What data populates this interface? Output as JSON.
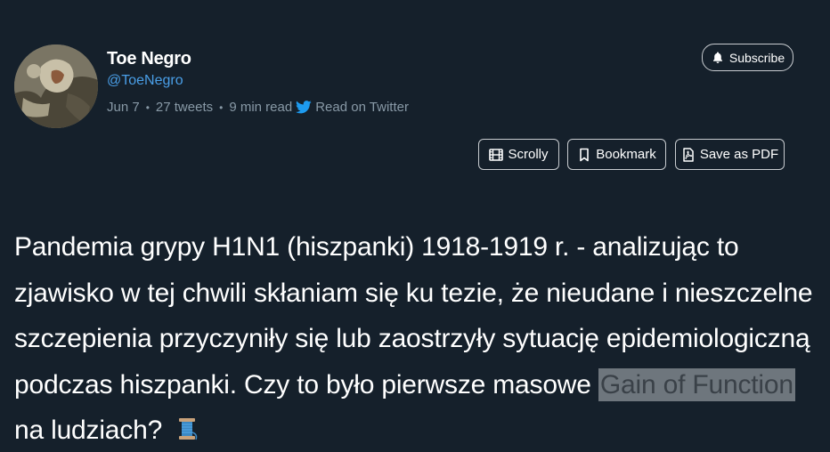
{
  "author": {
    "name": "Toe Negro",
    "handle": "@ToeNegro",
    "avatar": "avatar-image"
  },
  "meta": {
    "date": "Jun 7",
    "separator": "•",
    "tweets": "27 tweets",
    "read_time": "9 min read",
    "twitter_icon": "twitter-bird-icon",
    "read_on_twitter": "Read on Twitter"
  },
  "actions": {
    "subscribe": {
      "label": "Subscribe",
      "icon": "bell-icon"
    },
    "scrolly": {
      "label": "Scrolly",
      "icon": "film-icon"
    },
    "bookmark": {
      "label": "Bookmark",
      "icon": "bookmark-icon"
    },
    "save_pdf": {
      "label": "Save as PDF",
      "icon": "pdf-icon"
    }
  },
  "tweet": {
    "text_before": "Pandemia grypy H1N1 (hiszpanki) 1918-1919 r. - analizując to zjawisko w tej chwili skłaniam się ku tezie, że nieudane i nieszczelne szczepienia przyczyniły się lub zaostrzyły sytuację epidemiologiczną podczas hiszpanki. Czy to było pierwsze masowe ",
    "highlight": "Gain of Function",
    "text_after": " na ludziach? ",
    "emoji": "thread-spool-emoji"
  },
  "colors": {
    "background": "#15202b",
    "link": "#4a9fe8",
    "muted": "#8899a6",
    "highlight_bg": "#6e767d",
    "highlight_text": "#3a4148",
    "twitter_blue": "#1d9bf0"
  }
}
